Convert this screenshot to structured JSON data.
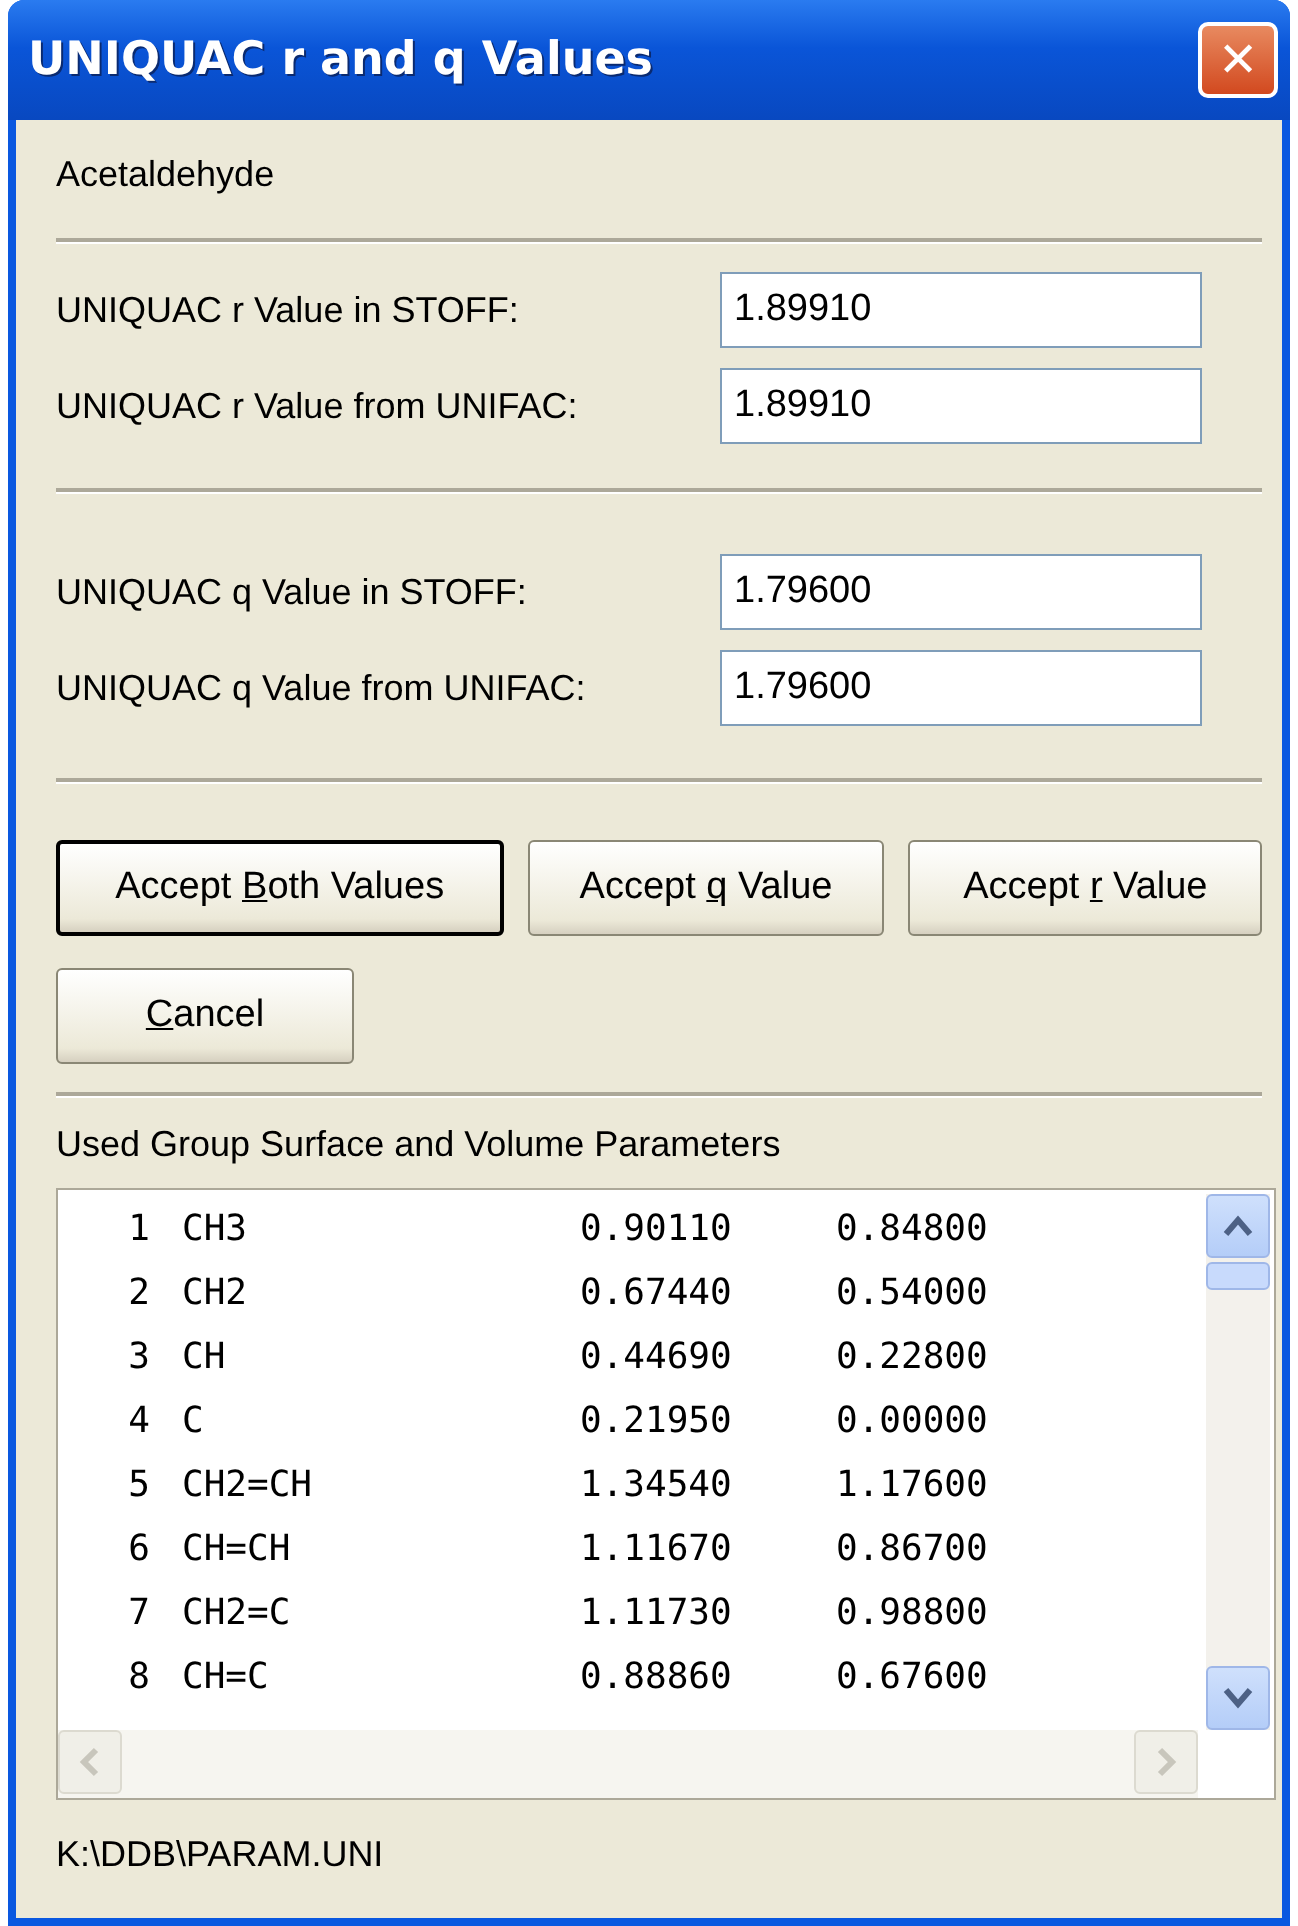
{
  "window": {
    "title": "UNIQUAC r and q Values",
    "close": "✕"
  },
  "component": "Acetaldehyde",
  "r_fields": [
    {
      "label": "UNIQUAC r Value in STOFF:",
      "value": "1.89910"
    },
    {
      "label": "UNIQUAC r Value from UNIFAC:",
      "value": "1.89910"
    }
  ],
  "q_fields": [
    {
      "label": "UNIQUAC q Value in STOFF:",
      "value": "1.79600"
    },
    {
      "label": "UNIQUAC q Value from UNIFAC:",
      "value": "1.79600"
    }
  ],
  "buttons": [
    {
      "before": "Accept ",
      "access_key": "B",
      "after": "oth Values",
      "default": true
    },
    {
      "before": "Accept ",
      "access_key": "q",
      "after": " Value",
      "default": false
    },
    {
      "before": "Accept ",
      "access_key": "r",
      "after": " Value",
      "default": false
    },
    {
      "access_key": "C",
      "after": "ancel",
      "default": false
    }
  ],
  "groups": {
    "title": "Used Group Surface and Volume Parameters",
    "rows": [
      {
        "no": "1",
        "group": "CH3",
        "r": "0.90110",
        "q": "0.84800"
      },
      {
        "no": "2",
        "group": "CH2",
        "r": "0.67440",
        "q": "0.54000"
      },
      {
        "no": "3",
        "group": "CH",
        "r": "0.44690",
        "q": "0.22800"
      },
      {
        "no": "4",
        "group": "C",
        "r": "0.21950",
        "q": "0.00000"
      },
      {
        "no": "5",
        "group": "CH2=CH",
        "r": "1.34540",
        "q": "1.17600"
      },
      {
        "no": "6",
        "group": "CH=CH",
        "r": "1.11670",
        "q": "0.86700"
      },
      {
        "no": "7",
        "group": "CH2=C",
        "r": "1.11730",
        "q": "0.98800"
      },
      {
        "no": "8",
        "group": "CH=C",
        "r": "0.88860",
        "q": "0.67600"
      }
    ]
  },
  "status": "K:\\DDB\\PARAM.UNI"
}
